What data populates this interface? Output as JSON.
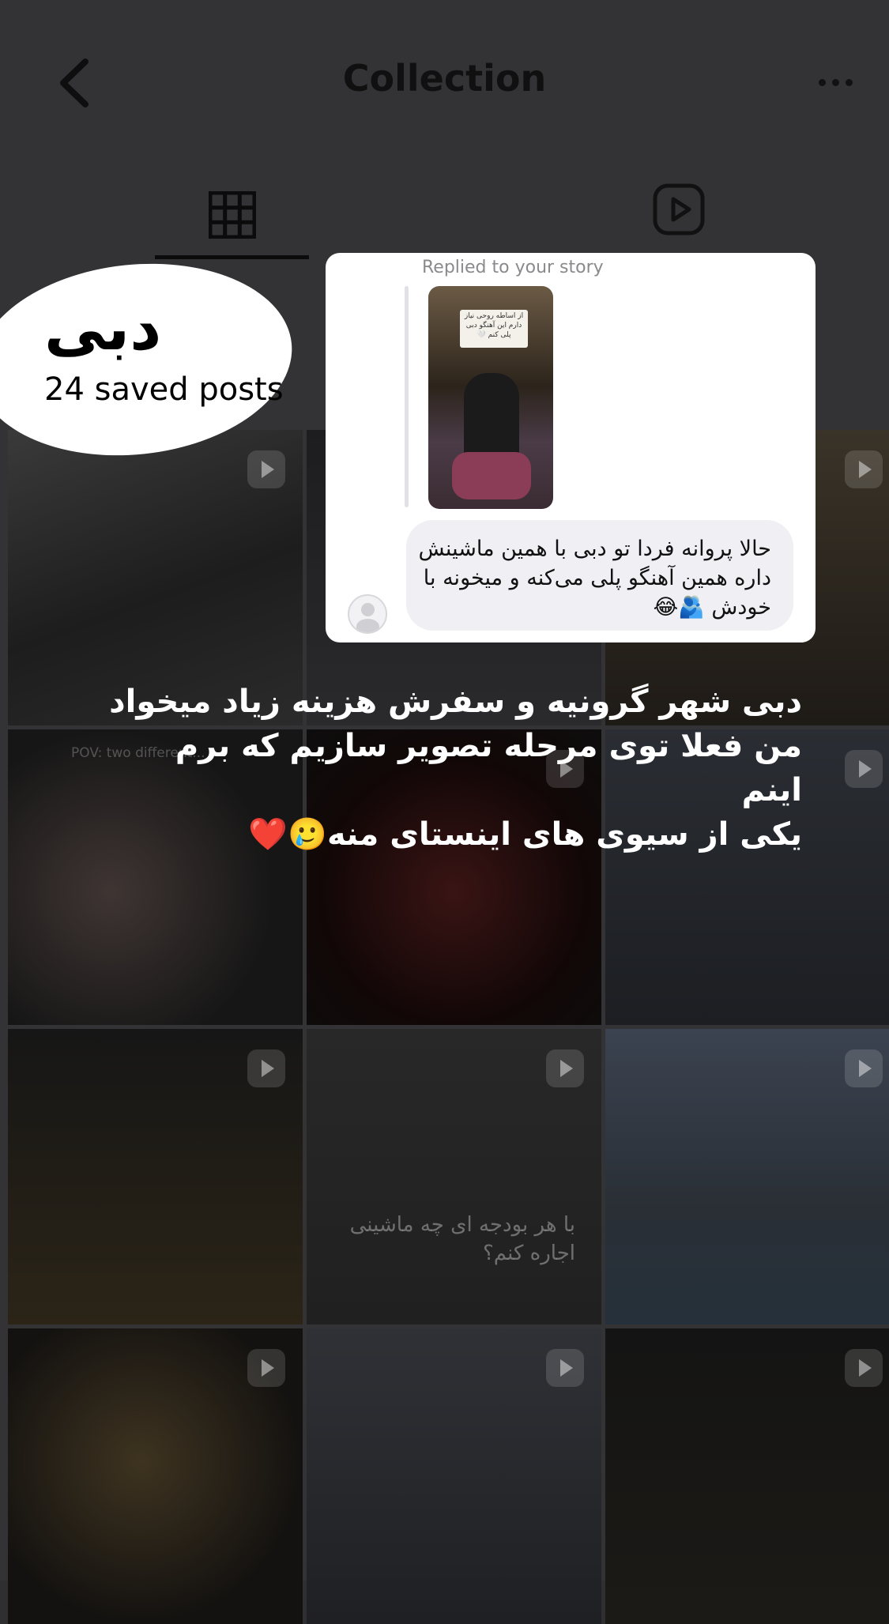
{
  "header": {
    "title": "Collection",
    "back_icon": "chevron-left-icon",
    "more_icon": "more-horizontal-icon"
  },
  "tabs": [
    {
      "name": "grid",
      "icon": "grid-icon",
      "active": true
    },
    {
      "name": "reels",
      "icon": "reels-icon",
      "active": false
    }
  ],
  "collection": {
    "name": "دبی",
    "count_label": "24 saved posts"
  },
  "story_reply": {
    "label": "Replied to your story",
    "story_sticker_text": "از اساطه روحی نیاز دارم این آهنگو دبی پلی کنم 🤍",
    "message": "حالا پروانه فردا تو دبی با همین ماشینش داره همین آهنگو پلی می‌کنه و میخونه با خودش 🫂😂"
  },
  "overlay_caption": {
    "line1": "دبی شهر گرونیه و سفرش هزینه زیاد میخواد",
    "line2": "من فعلا توی مرحله تصویر سازیم که برم اینم",
    "line3": "یکی از سیوی های اینستای منه🥲❤️"
  },
  "grid": {
    "tiles": [
      {
        "id": "t1",
        "reel": true
      },
      {
        "id": "t2",
        "reel": false
      },
      {
        "id": "t3",
        "reel": true
      },
      {
        "id": "t4",
        "reel": false,
        "caption": "POV: two different..."
      },
      {
        "id": "t5",
        "reel": true
      },
      {
        "id": "t6",
        "reel": true
      },
      {
        "id": "t7",
        "reel": true
      },
      {
        "id": "t8",
        "reel": true,
        "caption": "با هر بودجه ای چه ماشینی اجاره کنم؟"
      },
      {
        "id": "t9",
        "reel": true
      },
      {
        "id": "t10",
        "reel": true
      },
      {
        "id": "t11",
        "reel": true
      },
      {
        "id": "t12",
        "reel": true
      }
    ]
  },
  "colors": {
    "dim_overlay": "#333335",
    "card": "#ffffff",
    "bubble": "#efeff4"
  }
}
